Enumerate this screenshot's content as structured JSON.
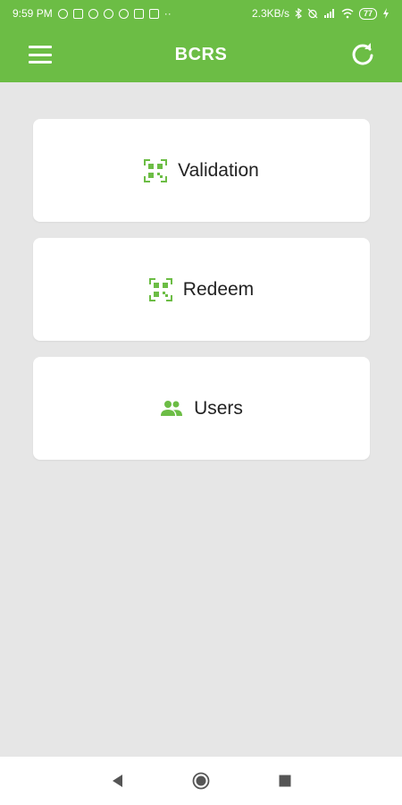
{
  "status_bar": {
    "time": "9:59 PM",
    "network_speed": "2.3KB/s",
    "battery": "77"
  },
  "app_bar": {
    "title": "BCRS",
    "menu_icon": "hamburger-menu-icon",
    "refresh_icon": "refresh-icon"
  },
  "menu": {
    "items": [
      {
        "label": "Validation",
        "icon": "qr-scan-icon"
      },
      {
        "label": "Redeem",
        "icon": "qr-scan-icon"
      },
      {
        "label": "Users",
        "icon": "users-icon"
      }
    ]
  },
  "nav_bar": {
    "back_icon": "back-triangle-icon",
    "home_icon": "home-circle-icon",
    "recents_icon": "recents-square-icon"
  },
  "colors": {
    "primary": "#6cbd45",
    "background": "#e6e6e6",
    "card": "#ffffff",
    "icon_green": "#6cbd45"
  }
}
